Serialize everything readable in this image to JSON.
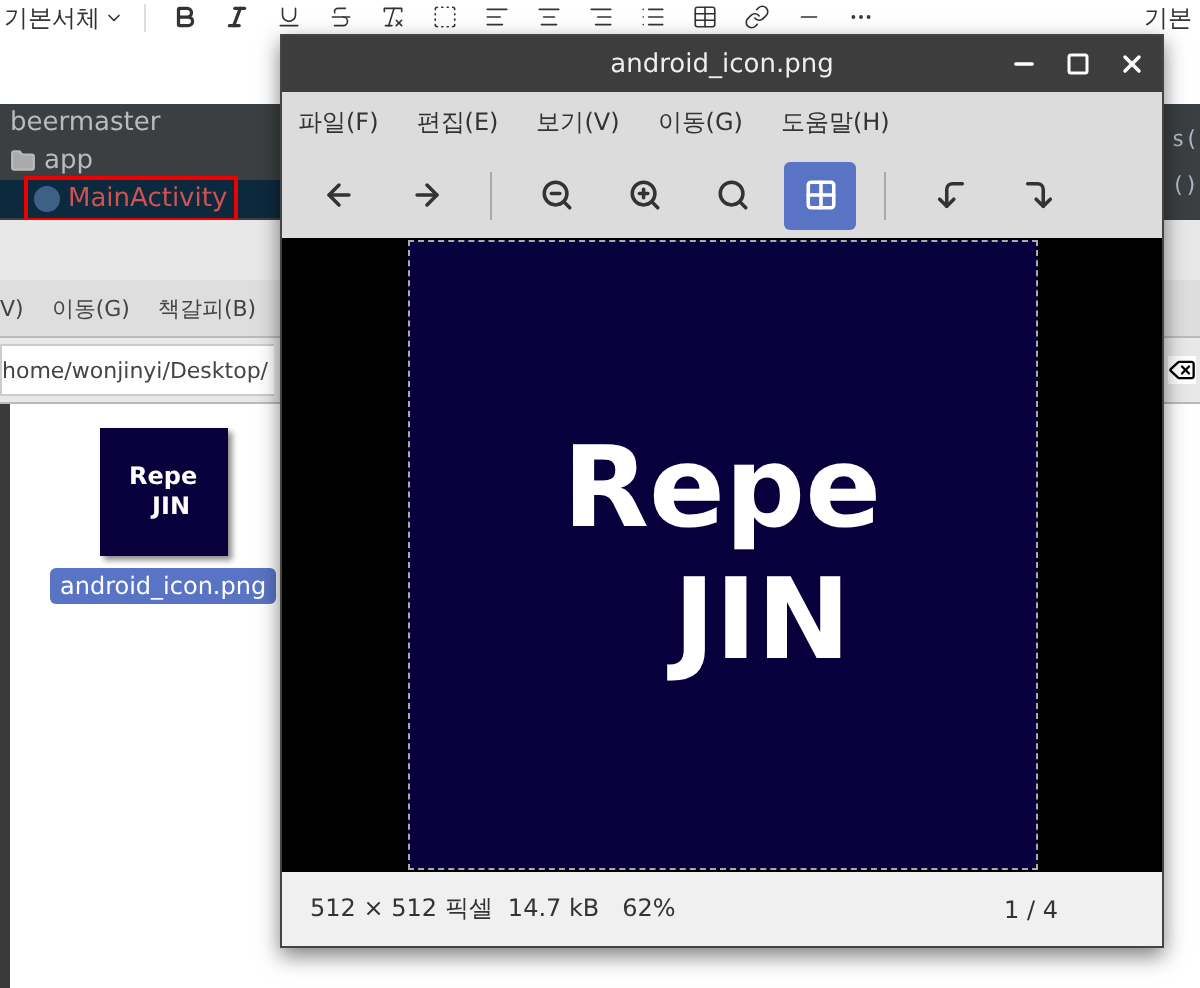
{
  "editor_toolbar": {
    "font_select": "기본서체",
    "right_label": "기본"
  },
  "ide": {
    "tree": [
      {
        "label": "beermaster",
        "kind": "project",
        "selected": false,
        "highlighted": false
      },
      {
        "label": "app",
        "kind": "folder",
        "selected": false,
        "highlighted": false
      },
      {
        "label": "MainActivity",
        "kind": "class",
        "selected": true,
        "highlighted": true
      }
    ],
    "code_fragments": [
      "s(",
      "()"
    ]
  },
  "file_manager": {
    "menu": [
      "V)",
      "이동(G)",
      "책갈피(B)"
    ],
    "path": "home/wonjinyi/Desktop/",
    "files": [
      {
        "name": "android_icon.png",
        "selected": true,
        "thumbnail_lines": [
          "Repe",
          "JIN"
        ]
      }
    ]
  },
  "viewer": {
    "title": "android_icon.png",
    "menu": [
      "파일(F)",
      "편집(E)",
      "보기(V)",
      "이동(G)",
      "도움말(H)"
    ],
    "toolbar": [
      {
        "kind": "back",
        "selected": false
      },
      {
        "kind": "forward",
        "selected": false
      },
      {
        "kind": "separator"
      },
      {
        "kind": "zoom_out",
        "selected": false
      },
      {
        "kind": "zoom_in",
        "selected": false
      },
      {
        "kind": "zoom_normal",
        "selected": false
      },
      {
        "kind": "best_fit",
        "selected": true
      },
      {
        "kind": "separator"
      },
      {
        "kind": "rotate_left",
        "selected": false
      },
      {
        "kind": "rotate_right",
        "selected": false
      }
    ],
    "image_lines": [
      "Repe",
      "JIN"
    ],
    "status": {
      "info": "512 × 512 픽셀  14.7 kB   62%",
      "position": "1 / 4"
    }
  }
}
